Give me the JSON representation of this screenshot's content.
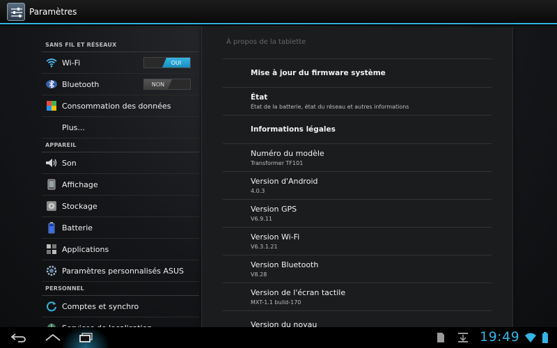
{
  "app": {
    "title": "Paramètres",
    "icon": "settings-sliders-icon"
  },
  "colors": {
    "accent": "#33b5e5",
    "background": "#151619",
    "panel": "#1b1c1e"
  },
  "left": {
    "sections": [
      {
        "header": "SANS FIL ET RÉSEAUX",
        "items": [
          {
            "label": "Wi-Fi",
            "icon": "wifi-icon",
            "toggle": "OUI",
            "state": "on"
          },
          {
            "label": "Bluetooth",
            "icon": "bluetooth-icon",
            "toggle": "NON",
            "state": "off"
          },
          {
            "label": "Consommation des données",
            "icon": "data-usage-icon"
          },
          {
            "label": "Plus...",
            "icon": ""
          }
        ]
      },
      {
        "header": "APPAREIL",
        "items": [
          {
            "label": "Son",
            "icon": "speaker-icon"
          },
          {
            "label": "Affichage",
            "icon": "display-icon"
          },
          {
            "label": "Stockage",
            "icon": "storage-icon"
          },
          {
            "label": "Batterie",
            "icon": "battery-icon"
          },
          {
            "label": "Applications",
            "icon": "apps-icon"
          },
          {
            "label": "Paramètres personnalisés ASUS",
            "icon": "asus-gear-icon"
          }
        ]
      },
      {
        "header": "PERSONNEL",
        "items": [
          {
            "label": "Comptes et synchro",
            "icon": "sync-icon"
          },
          {
            "label": "Services de localisation",
            "icon": "location-icon"
          }
        ]
      }
    ]
  },
  "right": {
    "header": "À propos de la tablette",
    "items": [
      {
        "title": "Mise à jour du firmware système",
        "subtitle": "",
        "bold": true
      },
      {
        "title": "État",
        "subtitle": "État de la batterie, état du réseau et autres informations",
        "bold": true
      },
      {
        "title": "Informations légales",
        "subtitle": "",
        "bold": true
      },
      {
        "title": "Numéro du modèle",
        "subtitle": "Transformer TF101"
      },
      {
        "title": "Version d'Android",
        "subtitle": "4.0.3"
      },
      {
        "title": "Version GPS",
        "subtitle": "V6.9.11"
      },
      {
        "title": "Version Wi-Fi",
        "subtitle": "V6.3.1.21"
      },
      {
        "title": "Version Bluetooth",
        "subtitle": "V8.28"
      },
      {
        "title": "Version de l'écran tactile",
        "subtitle": "MXT-1.1 build-170"
      },
      {
        "title": "Version du noyau",
        "subtitle": ""
      }
    ]
  },
  "systembar": {
    "time": "19:49",
    "nav": [
      "back-icon",
      "home-icon",
      "recent-apps-icon"
    ],
    "status": [
      "sdcard-icon",
      "download-icon",
      "wifi-signal-icon",
      "battery-status-icon"
    ]
  }
}
